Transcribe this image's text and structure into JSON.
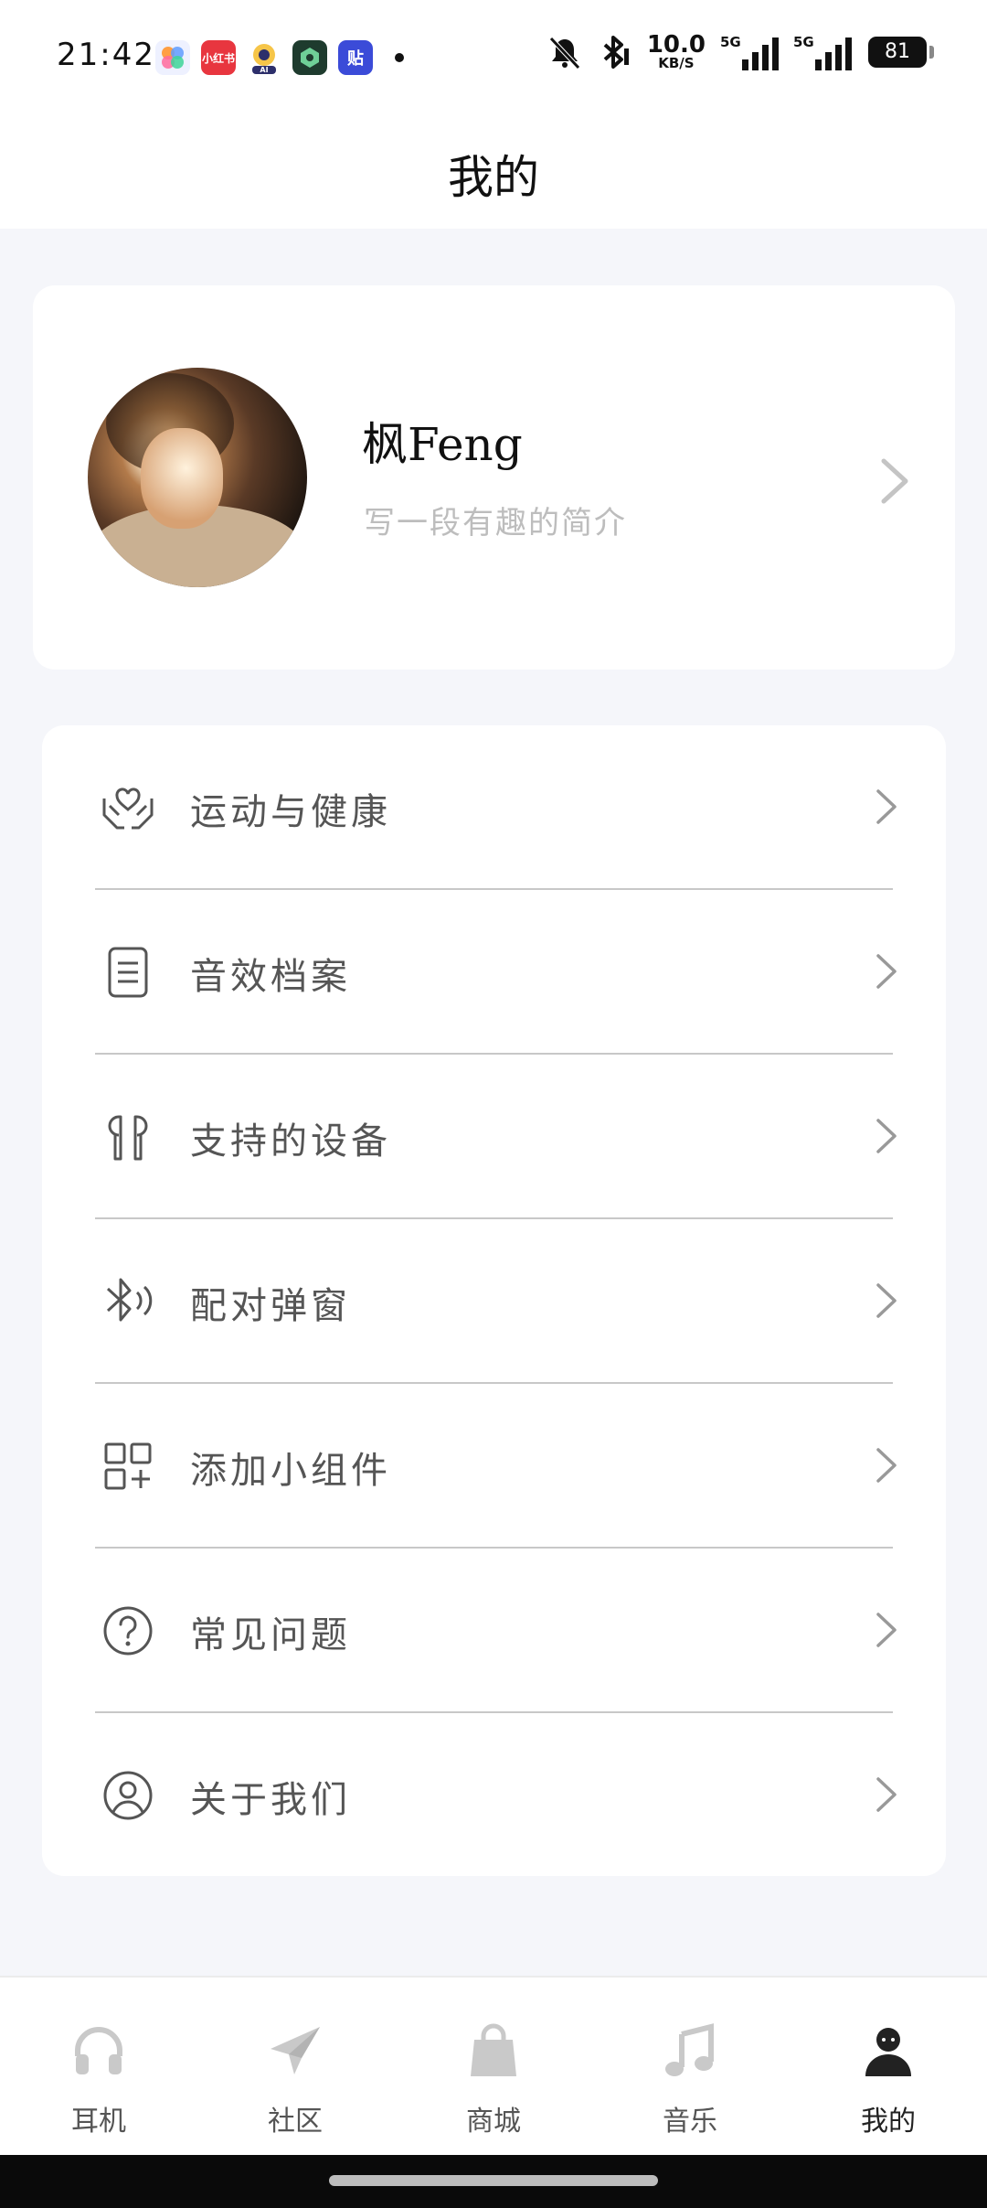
{
  "status_bar": {
    "time": "21:42",
    "notification_apps": [
      {
        "icon": "photos-app-icon",
        "label": "",
        "color": "#eef1ff"
      },
      {
        "icon": "xiaohongshu-app-icon",
        "label": "小红书",
        "color": "#e8363f"
      },
      {
        "icon": "ai-assistant-app-icon",
        "label": "AI",
        "color": "#2d2f6b"
      },
      {
        "icon": "shield-app-icon",
        "label": "",
        "color": "#1e3b2e"
      },
      {
        "icon": "tieba-app-icon",
        "label": "贴",
        "color": "#3b4bd8"
      }
    ],
    "net_speed": "10.0",
    "net_speed_unit": "KB/S",
    "signal1_label": "5G",
    "signal2_label": "5G",
    "battery": "81"
  },
  "header": {
    "title": "我的"
  },
  "profile": {
    "name": "枫Feng",
    "bio": "写一段有趣的简介"
  },
  "menu": [
    {
      "label": "运动与健康",
      "icon": "heart-hands-icon"
    },
    {
      "label": "音效档案",
      "icon": "document-icon"
    },
    {
      "label": "支持的设备",
      "icon": "earbuds-icon"
    },
    {
      "label": "配对弹窗",
      "icon": "bluetooth-icon"
    },
    {
      "label": "添加小组件",
      "icon": "add-widget-icon"
    },
    {
      "label": "常见问题",
      "icon": "question-icon"
    },
    {
      "label": "关于我们",
      "icon": "user-circle-icon"
    }
  ],
  "nav": [
    {
      "label": "耳机",
      "icon": "headphones-icon",
      "active": false
    },
    {
      "label": "社区",
      "icon": "paper-plane-icon",
      "active": false
    },
    {
      "label": "商城",
      "icon": "shopping-bag-icon",
      "active": false
    },
    {
      "label": "音乐",
      "icon": "music-note-icon",
      "active": false
    },
    {
      "label": "我的",
      "icon": "profile-icon",
      "active": true
    }
  ],
  "colors": {
    "accent": "#222222",
    "inactive_icon": "#c9c9c9",
    "background": "#f5f6fa"
  }
}
